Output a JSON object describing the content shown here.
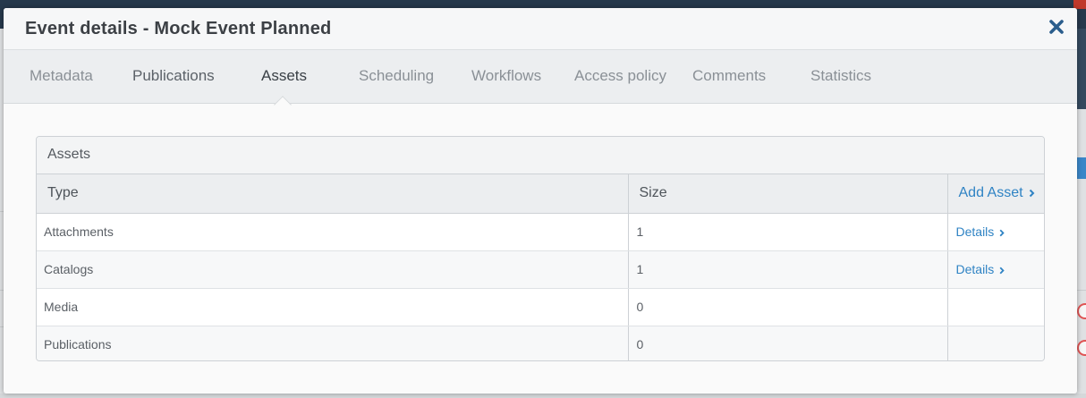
{
  "modal": {
    "title": "Event details - Mock Event Planned",
    "close_icon": "close-x-icon"
  },
  "tabs": [
    {
      "label": "Metadata"
    },
    {
      "label": "Publications"
    },
    {
      "label": "Assets",
      "active": true
    },
    {
      "label": "Scheduling"
    },
    {
      "label": "Workflows"
    },
    {
      "label": "Access policy"
    },
    {
      "label": "Comments"
    },
    {
      "label": "Statistics"
    }
  ],
  "assets_panel": {
    "heading": "Assets",
    "columns": {
      "type": "Type",
      "size": "Size",
      "action": "Add Asset"
    },
    "rows": [
      {
        "type": "Attachments",
        "size": "1",
        "action": "Details"
      },
      {
        "type": "Catalogs",
        "size": "1",
        "action": "Details"
      },
      {
        "type": "Media",
        "size": "0",
        "action": ""
      },
      {
        "type": "Publications",
        "size": "0",
        "action": ""
      }
    ]
  },
  "colors": {
    "link": "#2f83c4",
    "close": "#2a5d8c",
    "title": "#3c4045"
  }
}
